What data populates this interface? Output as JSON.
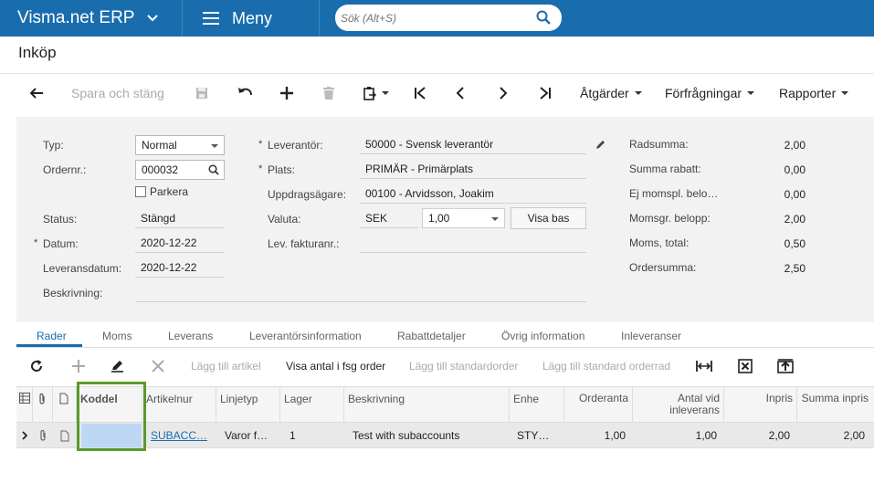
{
  "app": {
    "brand": "Visma.net ERP",
    "menu_label": "Meny",
    "search_placeholder": "Sök (Alt+S)"
  },
  "page": {
    "title": "Inköp"
  },
  "toolbar": {
    "save_close_label": "Spara och stäng",
    "actions_label": "Åtgärder",
    "inquiries_label": "Förfrågningar",
    "reports_label": "Rapporter"
  },
  "form": {
    "type_label": "Typ:",
    "type_value": "Normal",
    "order_no_label": "Ordernr.:",
    "order_no_value": "000032",
    "hold_label": "Parkera",
    "status_label": "Status:",
    "status_value": "Stängd",
    "date_label": "Datum:",
    "date_value": "2020-12-22",
    "delivery_date_label": "Leveransdatum:",
    "delivery_date_value": "2020-12-22",
    "description_label": "Beskrivning:",
    "vendor_label": "Leverantör:",
    "vendor_value": "50000 - Svensk leverantör",
    "location_label": "Plats:",
    "location_value": "PRIMÄR - Primärplats",
    "owner_label": "Uppdragsägare:",
    "owner_value": "00100 - Arvidsson, Joakim",
    "currency_label": "Valuta:",
    "currency_value": "SEK",
    "currency_rate": "1,00",
    "show_base_label": "Visa bas",
    "vendor_invoice_label": "Lev. fakturanr.:"
  },
  "summary": [
    {
      "label": "Radsumma:",
      "value": "2,00"
    },
    {
      "label": "Summa rabatt:",
      "value": "0,00"
    },
    {
      "label": "Ej momspl. belo…",
      "value": "0,00"
    },
    {
      "label": "Momsgr. belopp:",
      "value": "2,00"
    },
    {
      "label": "Moms, total:",
      "value": "0,50"
    },
    {
      "label": "Ordersumma:",
      "value": "2,50"
    }
  ],
  "tabs": [
    "Rader",
    "Moms",
    "Leverans",
    "Leverantörsinformation",
    "Rabattdetaljer",
    "Övrig information",
    "Inleveranser"
  ],
  "grid_toolbar": {
    "add_item": "Lägg till artikel",
    "show_qty": "Visa antal i fsg order",
    "add_std_order": "Lägg till standardorder",
    "add_std_order_row": "Lägg till standard orderrad"
  },
  "grid": {
    "columns": [
      "Koddel",
      "Artikelnur",
      "Linjetyp",
      "Lager",
      "Beskrivning",
      "Enhe",
      "Orderanta",
      "Antal vid inleverans",
      "Inpris",
      "Summa inpris"
    ],
    "rows": [
      [
        "",
        "SUBACC…",
        "Varor f…",
        "1",
        "Test with subaccounts",
        "STY…",
        "1,00",
        "1,00",
        "2,00",
        "2,00"
      ]
    ]
  },
  "colors": {
    "brand_blue": "#1a6dad",
    "highlight_green": "#5a9a2a"
  }
}
